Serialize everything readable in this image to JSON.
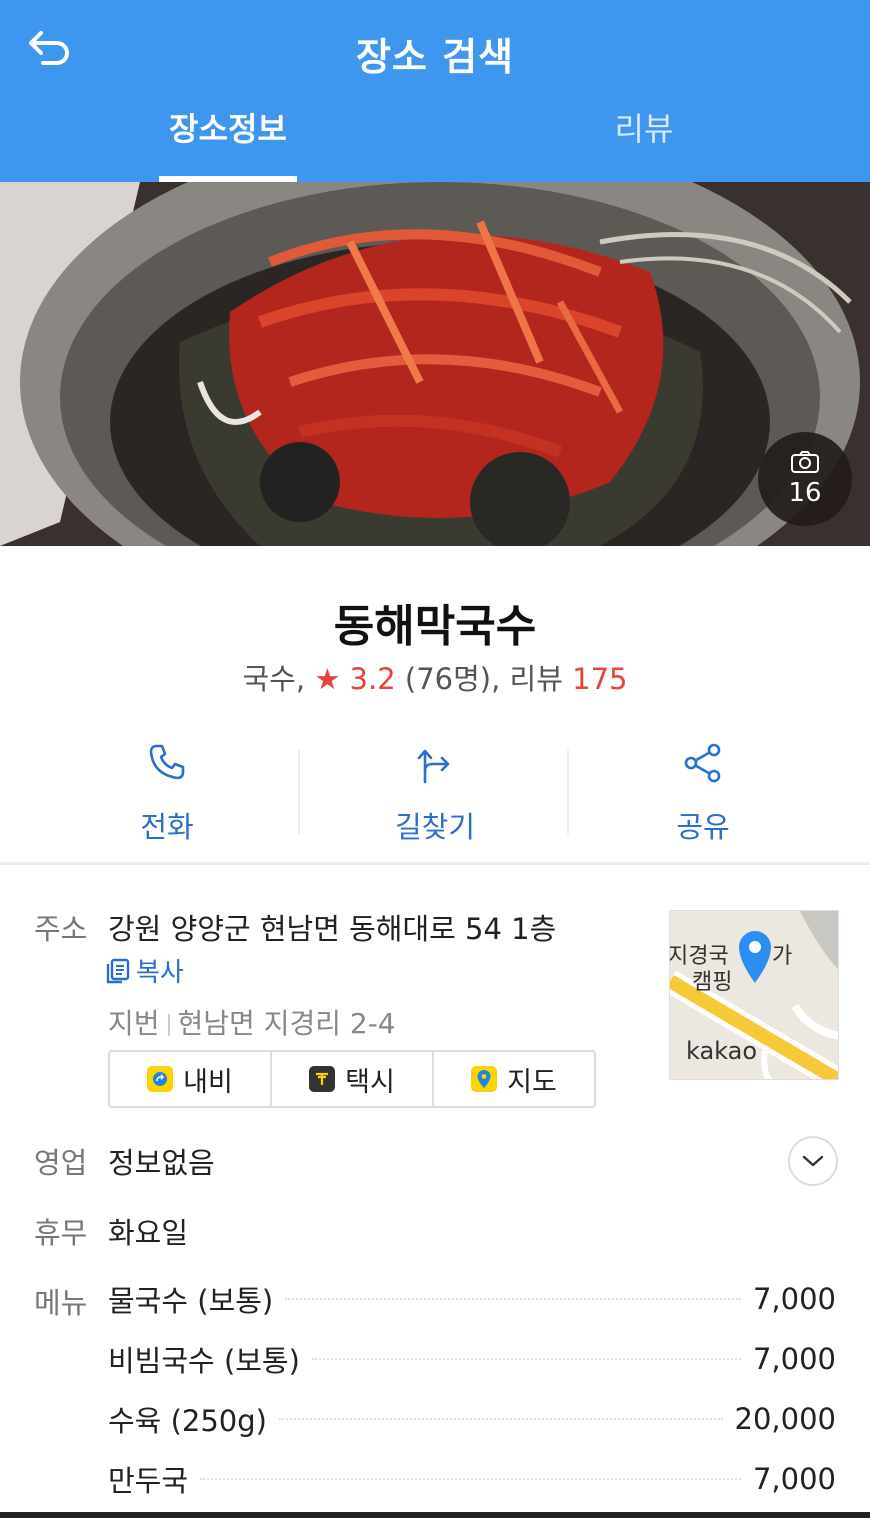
{
  "header": {
    "title": "장소 검색",
    "back_icon": "back-arrow-icon",
    "background": "#3f96ef"
  },
  "tabs": [
    {
      "label": "장소정보",
      "active": true
    },
    {
      "label": "리뷰",
      "active": false
    }
  ],
  "hero": {
    "photo_count": "16",
    "camera_icon": "camera-icon"
  },
  "place": {
    "name": "동해막국수",
    "category": "국수,",
    "star": "★",
    "rating": "3.2",
    "rating_count": "(76명),",
    "review_label": "리뷰",
    "review_count": "175"
  },
  "actions": [
    {
      "label": "전화",
      "icon": "phone-icon"
    },
    {
      "label": "길찾기",
      "icon": "directions-icon"
    },
    {
      "label": "공유",
      "icon": "share-icon"
    }
  ],
  "address": {
    "label": "주소",
    "value": "강원 양양군 현남면 동해대로 54 1층",
    "copy_label": "복사",
    "lot_label": "지번",
    "lot_value": "현남면 지경리 2-4"
  },
  "nav_buttons": [
    {
      "label": "내비",
      "icon": "navi-icon",
      "color": "#fcd500"
    },
    {
      "label": "택시",
      "icon": "taxi-icon",
      "color": "#333333"
    },
    {
      "label": "지도",
      "icon": "map-pin-icon",
      "color": "#fcd500"
    }
  ],
  "map": {
    "line1": "지경국",
    "line1b": "가",
    "line2": "캠핑",
    "brand": "kakao"
  },
  "hours": {
    "label": "영업",
    "value": "정보없음"
  },
  "closed": {
    "label": "휴무",
    "value": "화요일"
  },
  "menu": {
    "label": "메뉴",
    "items": [
      {
        "name": "물국수 (보통)",
        "price": "7,000"
      },
      {
        "name": "비빔국수 (보통)",
        "price": "7,000"
      },
      {
        "name": "수육 (250g)",
        "price": "20,000"
      },
      {
        "name": "만두국",
        "price": "7,000"
      }
    ]
  },
  "colors": {
    "accent_blue": "#2a6fc9",
    "rating_red": "#e8423b"
  }
}
